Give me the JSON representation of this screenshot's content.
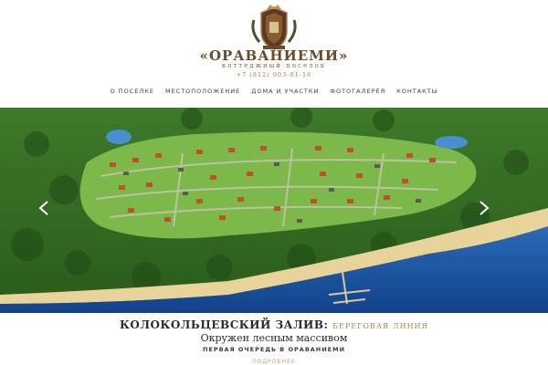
{
  "brand": {
    "name": "«ОРАВАНИЕМИ»",
    "subtitle": "коттеджный поселок",
    "phone": "+7 (812) 903-01-16",
    "crest_icon": "crest-logo-icon"
  },
  "nav": {
    "items": [
      {
        "label": "О ПОСЕЛКЕ"
      },
      {
        "label": "МЕСТОПОЛОЖЕНИЕ"
      },
      {
        "label": "ДОМА И УЧАСТКИ"
      },
      {
        "label": "ФОТОГАЛЕРЕЯ"
      },
      {
        "label": "КОНТАКТЫ"
      }
    ]
  },
  "slider": {
    "prev_icon": "chevron-left-icon",
    "next_icon": "chevron-right-icon"
  },
  "caption": {
    "title_main": "КОЛОКОЛЬЦЕВСКИЙ ЗАЛИВ:",
    "title_accent": "БЕРЕГОВАЯ ЛИНИЯ",
    "subtitle": "Окружен лесным массивом",
    "line": "ПЕРВАЯ ОЧЕРЕДЬ В ОРАВАНИЕМИ",
    "more": "ПОДРОБНЕЕ"
  },
  "colors": {
    "brand_brown": "#6b4a2a",
    "accent_gold": "#b08050",
    "water": "#1e5fb0",
    "forest": "#2f6a1f"
  }
}
